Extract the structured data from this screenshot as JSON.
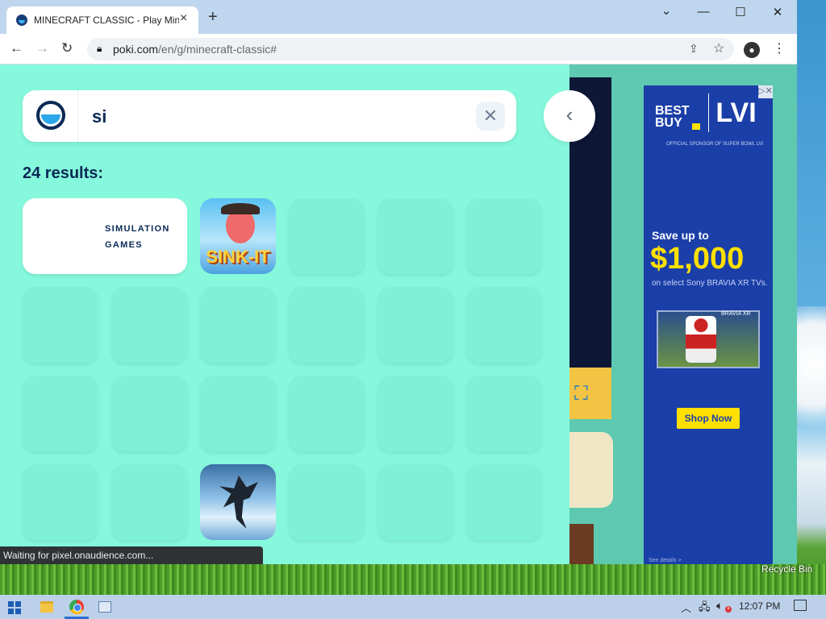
{
  "browser": {
    "tab_title": "MINECRAFT CLASSIC - Play Mine",
    "tab_close": "×",
    "new_tab": "+",
    "minimize": "—",
    "restore": "☐",
    "close": "✕",
    "caret": "⌄",
    "url_host": "poki.com",
    "url_path": "/en/g/minecraft-classic#",
    "status_text": "Waiting for pixel.onaudience.com..."
  },
  "search": {
    "query": "si",
    "clear_label": "✕",
    "back_label": "‹",
    "results_label": "24 results:"
  },
  "results": {
    "category_label": "SIMULATION GAMES",
    "sinkit_title": "SINK-IT"
  },
  "ad": {
    "logo": "BEST BUY",
    "event": "LVI",
    "sub": "OFFICIAL SPONSOR OF SUPER BOWL LVI",
    "headline": "Save up to",
    "price": "$1,000",
    "caption": "on select Sony BRAVIA XR TVs.",
    "tv_label": "BRAVIA XR",
    "cta": "Shop Now",
    "details": "See details >",
    "close": "▷✕"
  },
  "desktop": {
    "recycle_bin": "Recycle Bin"
  },
  "taskbar": {
    "time": "12:07 PM"
  },
  "icons": [
    "back-arrow-icon",
    "forward-arrow-icon",
    "reload-icon",
    "lock-icon",
    "share-icon",
    "star-icon",
    "profile-icon",
    "menu-icon",
    "poki-logo-icon",
    "clear-icon",
    "chevron-left-icon",
    "fullscreen-icon",
    "windows-start-icon",
    "file-explorer-icon",
    "chrome-icon",
    "network-icon",
    "volume-icon",
    "notification-icon"
  ],
  "colors": {
    "panel_bg": "#86f8dc",
    "tile_bg": "#7ff2d6",
    "poki_navy": "#0a2a55",
    "poki_blue": "#2ba7ea",
    "ad_blue": "#1b3fa8",
    "ad_yellow": "#ffe000"
  }
}
